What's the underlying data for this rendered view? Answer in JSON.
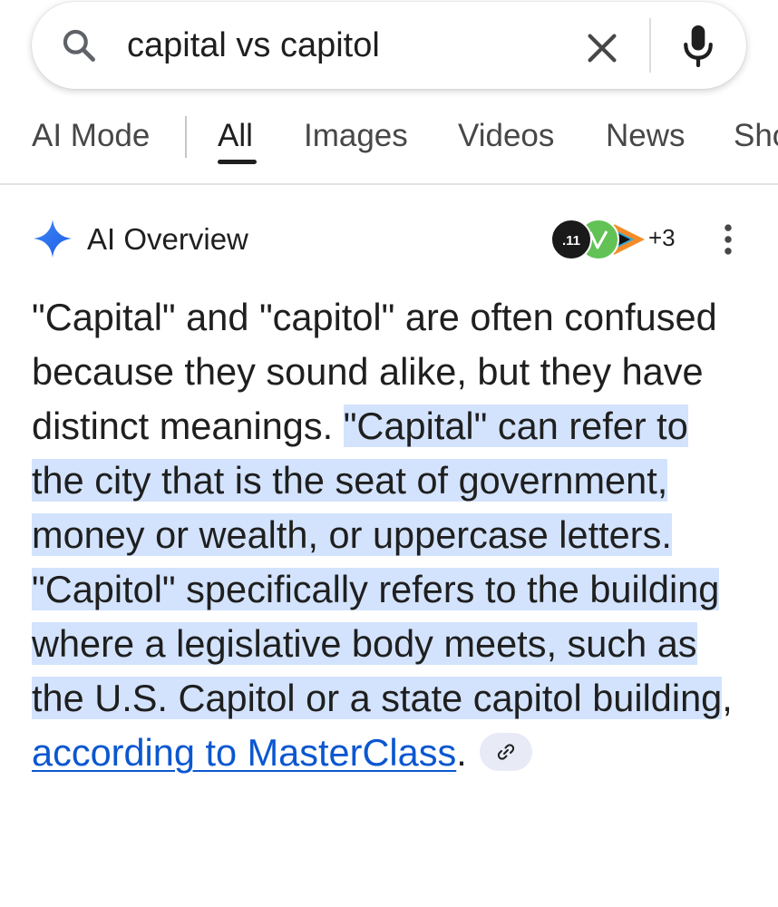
{
  "search": {
    "query": "capital vs capitol",
    "icons": {
      "search": "search-icon",
      "clear": "close-icon",
      "voice": "microphone-icon"
    }
  },
  "tabs": [
    {
      "label": "AI Mode",
      "active": false
    },
    {
      "label": "All",
      "active": true
    },
    {
      "label": "Images",
      "active": false
    },
    {
      "label": "Videos",
      "active": false
    },
    {
      "label": "News",
      "active": false
    },
    {
      "label": "Sho",
      "active": false
    }
  ],
  "ai_overview": {
    "title": "AI Overview",
    "sources_more": "+3",
    "icons": {
      "sparkle": "sparkle-icon",
      "more": "more-vertical-icon",
      "link": "link-icon"
    },
    "sources": [
      {
        "icon": "source-logo-1",
        "color": "#1a1a1a"
      },
      {
        "icon": "source-logo-2",
        "color": "#5bbf4f"
      },
      {
        "icon": "source-logo-3",
        "color": "#2ba8e0"
      }
    ],
    "intro": "\"Capital\" and \"capitol\" are often confused because they sound alike, but they have distinct meanings.",
    "highlight_capital": "\"Capital\" can refer to the city that is the seat of government, money or wealth, or uppercase letters.",
    "highlight_capitol": "\"Capitol\" specifically refers to the building where a legislative body meets, such as the U.S. Capitol or a state capitol building",
    "comma": ", ",
    "citation_link": "according to MasterClass",
    "period": "."
  },
  "colors": {
    "highlight": "#d3e3fd",
    "link": "#0b57d0",
    "sparkle_blue": "#1a73e8",
    "text": "#1f1f1f"
  }
}
